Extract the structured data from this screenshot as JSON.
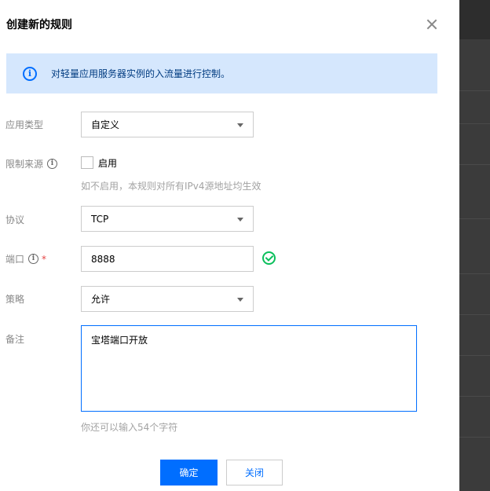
{
  "dialog": {
    "title": "创建新的规则",
    "notice": "对轻量应用服务器实例的入流量进行控制。"
  },
  "form": {
    "app_type": {
      "label": "应用类型",
      "value": "自定义"
    },
    "restrict_source": {
      "label": "限制来源",
      "checkbox_label": "启用",
      "checked": false,
      "help": "如不启用，本规则对所有IPv4源地址均生效"
    },
    "protocol": {
      "label": "协议",
      "value": "TCP"
    },
    "port": {
      "label": "端口",
      "required_mark": "*",
      "value": "8888"
    },
    "policy": {
      "label": "策略",
      "value": "允许"
    },
    "remark": {
      "label": "备注",
      "value": "宝塔端口开放",
      "help": "你还可以输入54个字符"
    }
  },
  "buttons": {
    "confirm": "确定",
    "close": "关闭"
  },
  "colors": {
    "primary": "#006eff",
    "notice_bg": "#d5e7fd",
    "success": "#0abf5b",
    "required": "#e54545"
  }
}
